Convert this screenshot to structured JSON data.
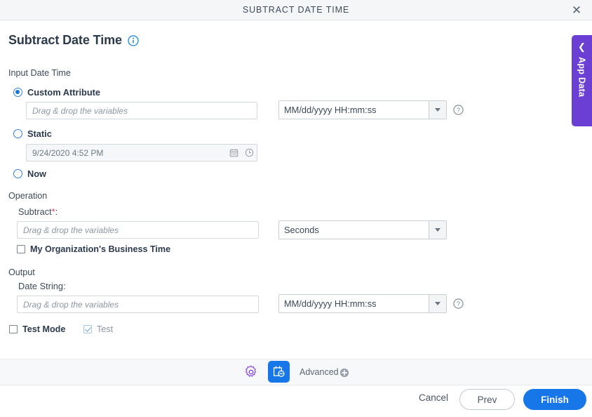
{
  "window": {
    "title": "SUBTRACT DATE TIME",
    "close_icon": "close-icon"
  },
  "header": {
    "title": "Subtract Date Time",
    "info_icon": "info-circle-icon"
  },
  "input_section": {
    "label": "Input Date Time",
    "options": [
      {
        "id": "custom-attribute",
        "label": "Custom Attribute",
        "selected": true
      },
      {
        "id": "static",
        "label": "Static",
        "selected": false
      },
      {
        "id": "now",
        "label": "Now",
        "selected": false
      }
    ],
    "custom_attribute_field": {
      "value": "",
      "placeholder": "Drag & drop the variables"
    },
    "format_select": {
      "value": "MM/dd/yyyy HH:mm:ss",
      "caret_icon": "chevron-down-icon"
    },
    "format_help_icon": "help-circle-icon",
    "static_field": {
      "value": "9/24/2020 4:52 PM",
      "calendar_icon": "calendar-icon",
      "clock_icon": "clock-icon"
    }
  },
  "operation_section": {
    "label": "Operation",
    "subtract_label": "Subtract",
    "required_marker": "*",
    "colon": ":",
    "subtract_field": {
      "value": "",
      "placeholder": "Drag & drop the variables"
    },
    "unit_select": {
      "value": "Seconds",
      "caret_icon": "chevron-down-icon"
    },
    "business_time_checkbox": {
      "label": "My Organization's Business Time",
      "checked": false
    }
  },
  "output_section": {
    "label": "Output",
    "date_string_label": "Date String:",
    "date_string_field": {
      "value": "",
      "placeholder": "Drag & drop the variables"
    },
    "format_select": {
      "value": "MM/dd/yyyy HH:mm:ss",
      "caret_icon": "chevron-down-icon"
    },
    "format_help_icon": "help-circle-icon"
  },
  "test_row": {
    "test_mode": {
      "label": "Test Mode",
      "checked": false
    },
    "test": {
      "label": "Test",
      "checked": true,
      "disabled": true
    }
  },
  "side_tab": {
    "label": "App Data",
    "chevron_icon": "chevron-left-icon",
    "color": "#6c3fd4"
  },
  "toolbar": {
    "gear_icon": "gear-icon",
    "active_tool_icon": "calendar-minus-icon",
    "advanced_label": "Advanced",
    "advanced_add_icon": "plus-circle-icon"
  },
  "footer": {
    "cancel_label": "Cancel",
    "prev_label": "Prev",
    "finish_label": "Finish"
  },
  "colors": {
    "accent_blue": "#1877e8",
    "purple": "#6c3fd4",
    "required_red": "#d0455a"
  }
}
